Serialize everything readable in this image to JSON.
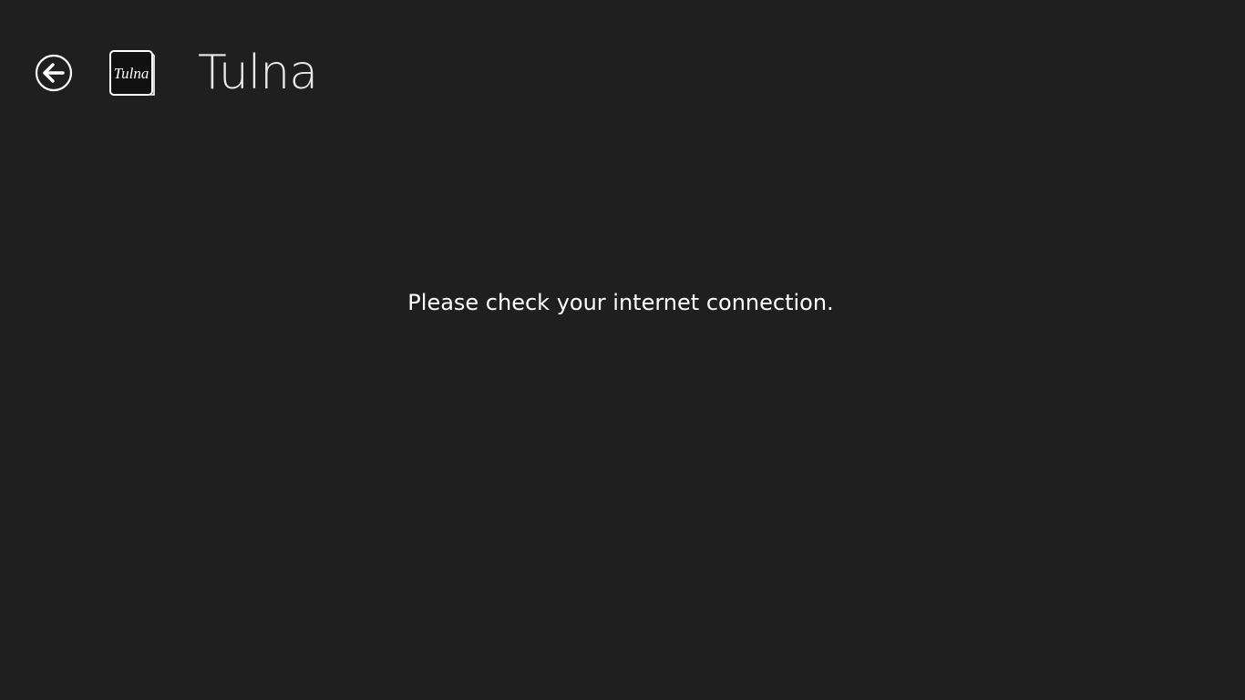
{
  "header": {
    "title": "Tulna",
    "logo_text": "Tulna",
    "back_icon": "back-arrow-circle-icon"
  },
  "main": {
    "message": "Please check your internet connection."
  },
  "colors": {
    "background": "#1f1f1f",
    "foreground": "#ffffff",
    "title": "#e8e8e8"
  }
}
